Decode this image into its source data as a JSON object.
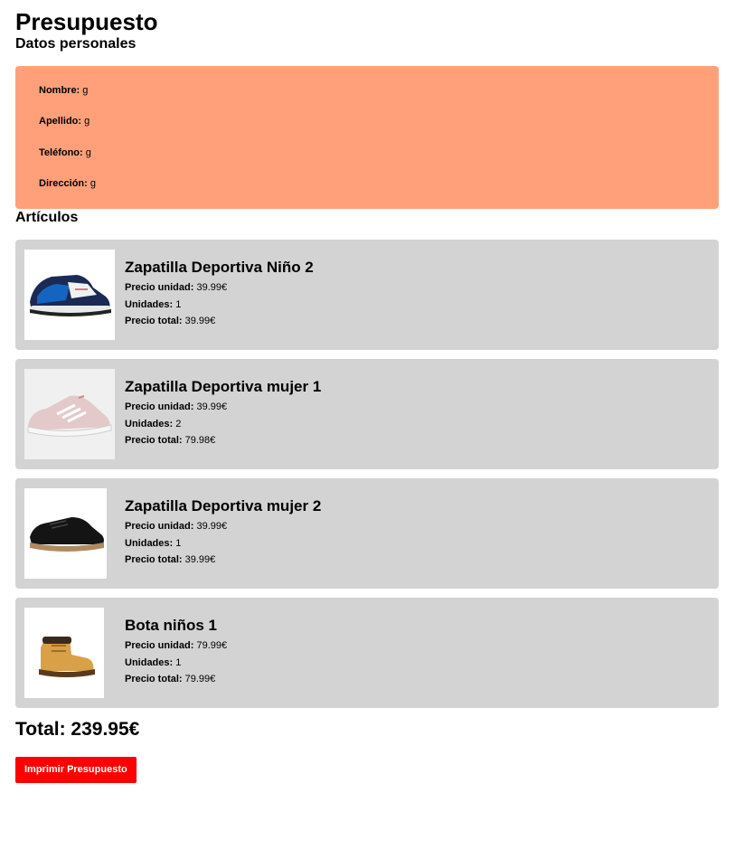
{
  "header": {
    "title": "Presupuesto"
  },
  "personal": {
    "heading": "Datos personales",
    "fields": [
      {
        "label": "Nombre:",
        "value": "g"
      },
      {
        "label": "Apellido:",
        "value": "g"
      },
      {
        "label": "Teléfono:",
        "value": "g"
      },
      {
        "label": "Dirección:",
        "value": "g"
      }
    ],
    "background_color": "#ffa07a"
  },
  "articles": {
    "heading": "Artículos",
    "unit_label": "Precio unidad:",
    "qty_label": "Unidades:",
    "total_label": "Precio total:",
    "items": [
      {
        "name": "Zapatilla Deportiva Niño 2",
        "unit_price": "39.99€",
        "units": "1",
        "total": "39.99€",
        "image": "kids-sneaker-blue-white"
      },
      {
        "name": "Zapatilla Deportiva mujer 1",
        "unit_price": "39.99€",
        "units": "2",
        "total": "79.98€",
        "image": "women-running-shoe-pink"
      },
      {
        "name": "Zapatilla Deportiva mujer 2",
        "unit_price": "39.99€",
        "units": "1",
        "total": "39.99€",
        "image": "women-sneaker-black-suede"
      },
      {
        "name": "Bota niños 1",
        "unit_price": "79.99€",
        "units": "1",
        "total": "79.99€",
        "image": "kids-boot-tan"
      }
    ]
  },
  "summary": {
    "total_text": "Total: 239.95€"
  },
  "actions": {
    "print_label": "Imprimir Presupuesto",
    "print_color": "#ff0000"
  }
}
